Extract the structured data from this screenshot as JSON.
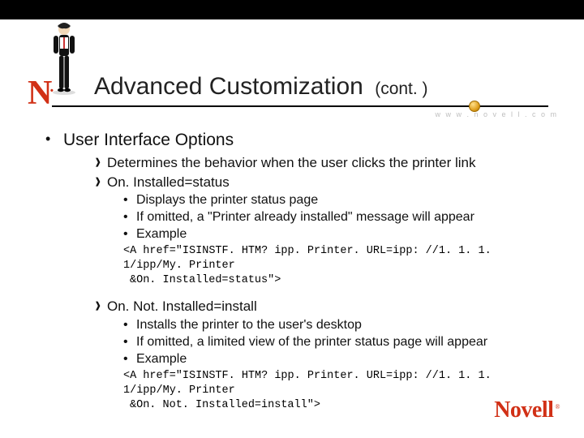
{
  "brand": {
    "n_mark": "N",
    "www": "w w w . n o v e l l . c o m",
    "footer_logo": "Novell",
    "reg": "®"
  },
  "title": {
    "main": "Advanced Customization",
    "cont": "(cont. )"
  },
  "content": {
    "h1": "User Interface Options",
    "sub1_a": "Determines the behavior when the user clicks the printer link",
    "sub1_b": "On. Installed=status",
    "b1_1": "Displays the printer status page",
    "b1_2": "If omitted, a \"Printer already installed\" message will appear",
    "b1_3": "Example",
    "code1_l1": "<A href=\"ISINSTF. HTM? ipp. Printer. URL=ipp: //1. 1. 1. 1/ipp/My. Printer",
    "code1_l2": "&On. Installed=status\">",
    "sub2": "On. Not. Installed=install",
    "b2_1": "Installs the printer to the user's desktop",
    "b2_2": "If omitted, a limited view of the printer status page will appear",
    "b2_3": "Example",
    "code2_l1": "<A href=\"ISINSTF. HTM? ipp. Printer. URL=ipp: //1. 1. 1. 1/ipp/My. Printer",
    "code2_l2": "&On. Not. Installed=install\">"
  }
}
